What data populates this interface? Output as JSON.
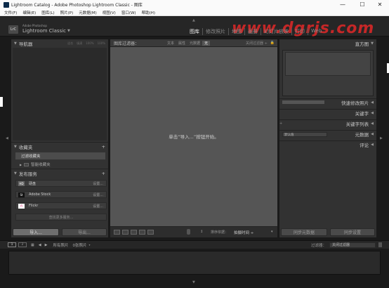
{
  "window": {
    "title": "Lightroom Catalog - Adobe Photoshop Lightroom Classic - 图库",
    "controls": [
      "—",
      "☐",
      "✕"
    ]
  },
  "menu": [
    "文件(F)",
    "编辑(E)",
    "图库(L)",
    "照片(P)",
    "元数据(M)",
    "视图(V)",
    "窗口(W)",
    "帮助(H)"
  ],
  "identity": {
    "logo": "LrC",
    "brand_small": "Adobe Photoshop",
    "brand_main": "Lightroom Classic",
    "arrow": "▼",
    "watermark": "www.dgrjs.com"
  },
  "modules": [
    "图库",
    "修改照片",
    "地图",
    "画册",
    "幻灯片放映",
    "打印",
    "Web"
  ],
  "left_panel": {
    "navigator": {
      "title": "导航器",
      "zoom": [
        "适合",
        "填满",
        "100%",
        "100%"
      ]
    },
    "collections": {
      "title": "收藏夹",
      "plus": "+",
      "items": [
        "过滤收藏夹",
        "智能收藏夹"
      ]
    },
    "publish": {
      "title": "发布服务",
      "plus": "+",
      "services": [
        {
          "icon": "HD",
          "name": "硬盘",
          "action": "设置..."
        },
        {
          "icon": "St",
          "name": "Adobe Stock",
          "action": "设置..."
        },
        {
          "icon": "fl",
          "name": "Flickr",
          "action": "设置..."
        }
      ],
      "find_more": "查找更多服务..."
    },
    "import_btn": "导入...",
    "export_btn": "导出..."
  },
  "center": {
    "filter_title": "图库过滤器：",
    "filter_tabs": [
      "文本",
      "属性",
      "元数据",
      "无"
    ],
    "filter_preset": "关闭过滤器 ÷",
    "message": "单击“导入...”按钮开始。",
    "toolbar": {
      "sort_label": "排序依据：",
      "sort_value": "拍摄时间 ÷"
    }
  },
  "right_panel": {
    "histogram": "直方图",
    "quick_develop": "快速修改照片",
    "keywords": "关键字",
    "keyword_list": "关键字列表",
    "metadata": "元数据",
    "metadata_preset": "默认值",
    "comments": "评论",
    "sync_metadata": "同步元数据",
    "sync_settings": "同步设置"
  },
  "filmstrip_bar": {
    "numbers": [
      "1",
      "2"
    ],
    "source": "所有照片",
    "count": "0张照片",
    "filter_label": "过滤器：",
    "filter_value": "关闭过滤器"
  },
  "colors": {
    "panel": "#323232",
    "center": "#555555",
    "watermark": "#e22828"
  }
}
